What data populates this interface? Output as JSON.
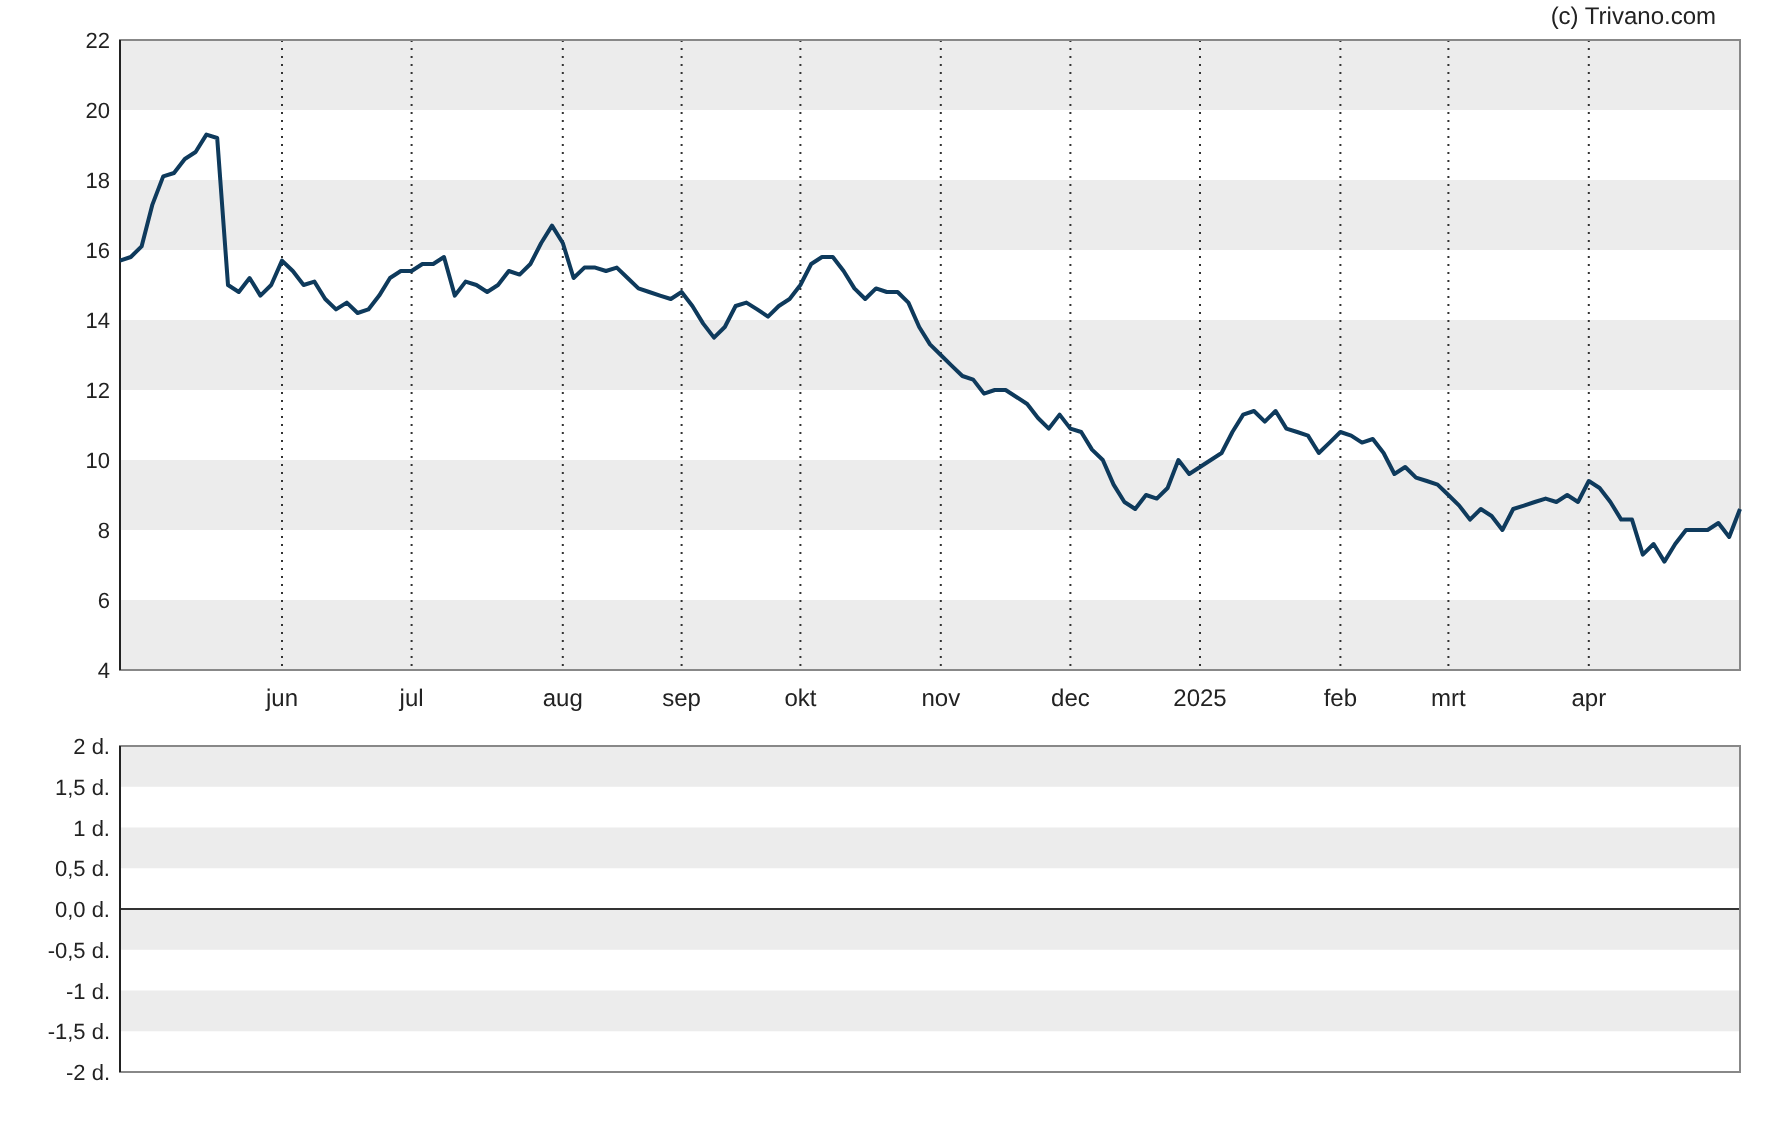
{
  "credit": "(c) Trivano.com",
  "price_chart": {
    "chart_data": {
      "type": "line",
      "ylim": [
        4,
        22
      ],
      "yticks": [
        4,
        6,
        8,
        10,
        12,
        14,
        16,
        18,
        20,
        22
      ],
      "categories": [
        null,
        null,
        null,
        null,
        null,
        null,
        null,
        null,
        null,
        null,
        null,
        null,
        null,
        null,
        null,
        "jun",
        null,
        null,
        null,
        null,
        null,
        null,
        null,
        null,
        null,
        null,
        null,
        "jul",
        null,
        null,
        null,
        null,
        null,
        null,
        null,
        null,
        null,
        null,
        null,
        null,
        null,
        "aug",
        null,
        null,
        null,
        null,
        null,
        null,
        null,
        null,
        null,
        null,
        "sep",
        null,
        null,
        null,
        null,
        null,
        null,
        null,
        null,
        null,
        null,
        "okt",
        null,
        null,
        null,
        null,
        null,
        null,
        null,
        null,
        null,
        null,
        null,
        null,
        "nov",
        null,
        null,
        null,
        null,
        null,
        null,
        null,
        null,
        null,
        null,
        null,
        "dec",
        null,
        null,
        null,
        null,
        null,
        null,
        null,
        null,
        null,
        null,
        null,
        "2025",
        null,
        null,
        null,
        null,
        null,
        null,
        null,
        null,
        null,
        null,
        null,
        null,
        "feb",
        null,
        null,
        null,
        null,
        null,
        null,
        null,
        null,
        null,
        "mrt",
        null,
        null,
        null,
        null,
        null,
        null,
        null,
        null,
        null,
        null,
        null,
        null,
        "apr",
        null,
        null,
        null,
        null,
        null,
        null,
        null,
        null,
        null,
        null,
        null,
        null,
        null,
        null
      ],
      "series": [
        {
          "color": "#0e3a5c",
          "values": [
            15.7,
            15.8,
            16.1,
            17.3,
            18.1,
            18.2,
            18.6,
            18.8,
            19.3,
            19.2,
            15.0,
            14.8,
            15.2,
            14.7,
            15.0,
            15.7,
            15.4,
            15.0,
            15.1,
            14.6,
            14.3,
            14.5,
            14.2,
            14.3,
            14.7,
            15.2,
            15.4,
            15.4,
            15.6,
            15.6,
            15.8,
            14.7,
            15.1,
            15.0,
            14.8,
            15.0,
            15.4,
            15.3,
            15.6,
            16.2,
            16.7,
            16.2,
            15.2,
            15.5,
            15.5,
            15.4,
            15.5,
            15.2,
            14.9,
            14.8,
            14.7,
            14.6,
            14.8,
            14.4,
            13.9,
            13.5,
            13.8,
            14.4,
            14.5,
            14.3,
            14.1,
            14.4,
            14.6,
            15.0,
            15.6,
            15.8,
            15.8,
            15.4,
            14.9,
            14.6,
            14.9,
            14.8,
            14.8,
            14.5,
            13.8,
            13.3,
            13.0,
            12.7,
            12.4,
            12.3,
            11.9,
            12.0,
            12.0,
            11.8,
            11.6,
            11.2,
            10.9,
            11.3,
            10.9,
            10.8,
            10.3,
            10.0,
            9.3,
            8.8,
            8.6,
            9.0,
            8.9,
            9.2,
            10.0,
            9.6,
            9.8,
            10.0,
            10.2,
            10.8,
            11.3,
            11.4,
            11.1,
            11.4,
            10.9,
            10.8,
            10.7,
            10.2,
            10.5,
            10.8,
            10.7,
            10.5,
            10.6,
            10.2,
            9.6,
            9.8,
            9.5,
            9.4,
            9.3,
            9.0,
            8.7,
            8.3,
            8.6,
            8.4,
            8.0,
            8.6,
            8.7,
            8.8,
            8.9,
            8.8,
            9.0,
            8.8,
            9.4,
            9.2,
            8.8,
            8.3,
            8.3,
            7.3,
            7.6,
            7.1,
            7.6,
            8.0,
            8.0,
            8.0,
            8.2,
            7.8,
            8.6
          ]
        }
      ]
    }
  },
  "dividend_panel": {
    "axis_labels": [
      "2 d.",
      "1,5 d.",
      "1 d.",
      "0,5 d.",
      "0,0 d.",
      "-0,5 d.",
      "-1 d.",
      "-1,5 d.",
      "-2 d."
    ]
  }
}
